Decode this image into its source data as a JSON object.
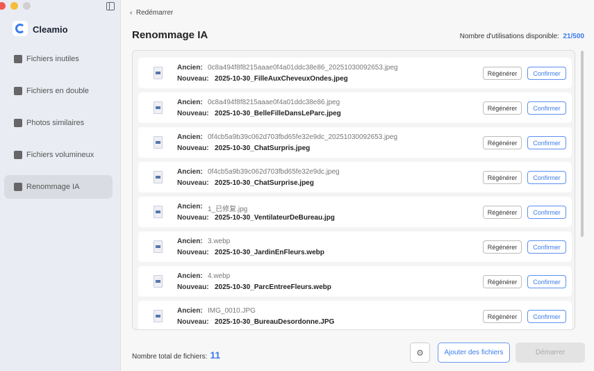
{
  "app": {
    "name": "Cleamio",
    "colors": {
      "accent": "#3b7be9"
    }
  },
  "sidebar": {
    "items": [
      {
        "label": "Fichiers inutiles",
        "icon": "broom-icon"
      },
      {
        "label": "Fichiers en double",
        "icon": "folder-icon"
      },
      {
        "label": "Photos similaires",
        "icon": "photo-icon"
      },
      {
        "label": "Fichiers volumineux",
        "icon": "zip-icon"
      },
      {
        "label": "Renommage IA",
        "icon": "rename-icon",
        "active": true
      }
    ]
  },
  "header": {
    "back": "Redémarrer",
    "title": "Renommage IA",
    "usage_label": "Nombre d'utilisations disponible:",
    "usage_value": "21/500"
  },
  "list": {
    "old_label": "Ancien:",
    "new_label": "Nouveau:",
    "regen_label": "Régénérer",
    "confirm_label": "Confirmer",
    "items": [
      {
        "old": "0c8a494f8f8215aaae0f4a01ddc38e86_20251030092653.jpeg",
        "new": "2025-10-30_FilleAuxCheveuxOndes.jpeg"
      },
      {
        "old": "0c8a494f8f8215aaae0f4a01ddc38e86.jpeg",
        "new": "2025-10-30_BelleFilleDansLeParc.jpeg"
      },
      {
        "old": "0f4cb5a9b39c062d703fbd65fe32e9dc_20251030092653.jpeg",
        "new": "2025-10-30_ChatSurpris.jpeg"
      },
      {
        "old": "0f4cb5a9b39c062d703fbd65fe32e9dc.jpeg",
        "new": "2025-10-30_ChatSurprise.jpeg"
      },
      {
        "old": "1_已修复.jpg",
        "new": "2025-10-30_VentilateurDeBureau.jpg"
      },
      {
        "old": "3.webp",
        "new": "2025-10-30_JardinEnFleurs.webp"
      },
      {
        "old": "4.webp",
        "new": "2025-10-30_ParcEntreeFleurs.webp"
      },
      {
        "old": "IMG_0010.JPG",
        "new": "2025-10-30_BureauDesordonne.JPG"
      }
    ]
  },
  "footer": {
    "total_label": "Nombre total de fichiers:",
    "total_value": "11",
    "add_label": "Ajouter des fichiers",
    "start_label": "Démarrer"
  }
}
